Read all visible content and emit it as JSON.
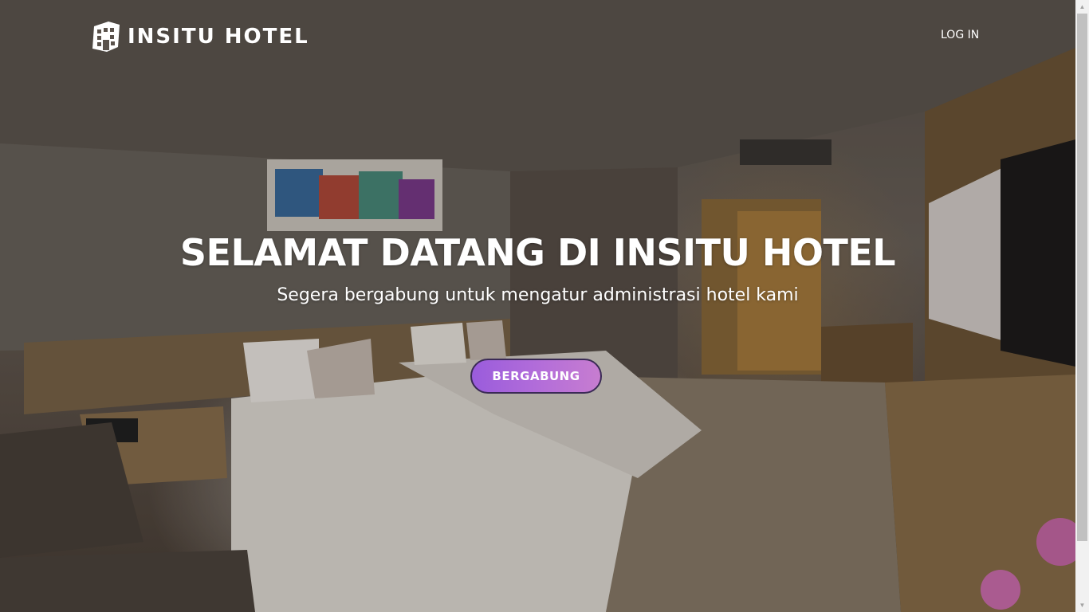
{
  "navbar": {
    "brand_name": "INSITU HOTEL",
    "brand_icon": "hotel-building-icon",
    "login_label": "LOG IN"
  },
  "hero": {
    "title": "SELAMAT DATANG DI INSITU HOTEL",
    "subtitle": "Segera bergabung untuk mengatur administrasi hotel kami",
    "cta_label": "BERGABUNG",
    "background_image": "hotel-room-photo"
  },
  "colors": {
    "cta_gradient_start": "#9a5cdc",
    "cta_gradient_end": "#c77dd0",
    "text": "#ffffff"
  },
  "scrollbar": {
    "position_fraction": 0.0
  }
}
